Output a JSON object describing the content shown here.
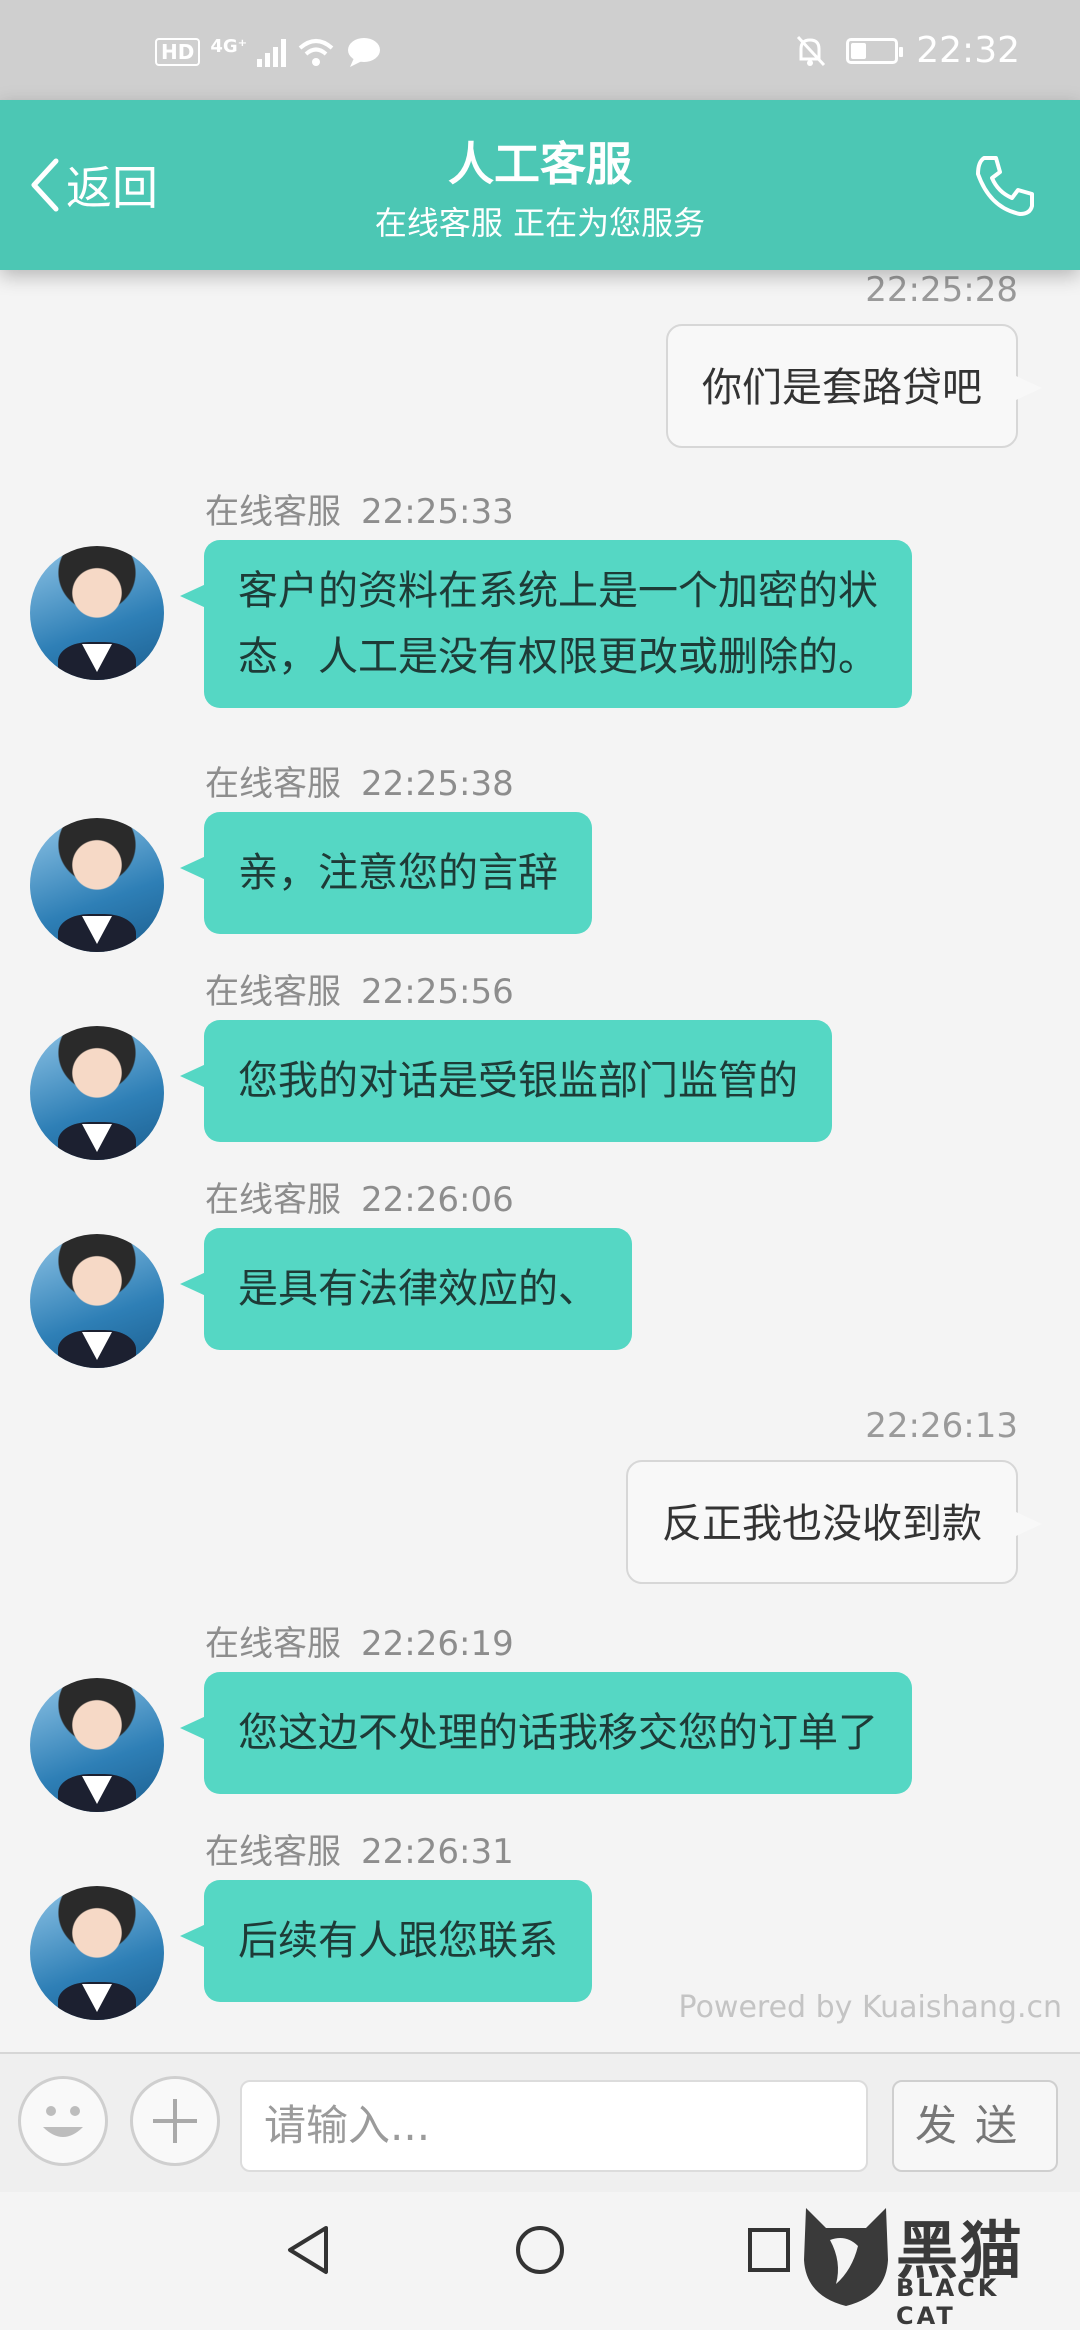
{
  "status_bar": {
    "hd": "HD",
    "network": "4G⁺",
    "time": "22:32",
    "battery_level": 0.35
  },
  "header": {
    "back_label": "返回",
    "title": "人工客服",
    "subtitle": "在线客服 正在为您服务"
  },
  "messages": [
    {
      "side": "user",
      "time": "22:25:28",
      "text": "你们是套路贷吧"
    },
    {
      "side": "agent",
      "name": "在线客服",
      "time": "22:25:33",
      "lines": [
        "客户的资料在系统上是一个加密的状",
        "态，人工是没有权限更改或删除的。"
      ]
    },
    {
      "side": "agent",
      "name": "在线客服",
      "time": "22:25:38",
      "lines": [
        "亲，注意您的言辞"
      ]
    },
    {
      "side": "agent",
      "name": "在线客服",
      "time": "22:25:56",
      "lines": [
        "您我的对话是受银监部门监管的"
      ]
    },
    {
      "side": "agent",
      "name": "在线客服",
      "time": "22:26:06",
      "lines": [
        "是具有法律效应的、"
      ]
    },
    {
      "side": "user",
      "time": "22:26:13",
      "text": "反正我也没收到款"
    },
    {
      "side": "agent",
      "name": "在线客服",
      "time": "22:26:19",
      "lines": [
        "您这边不处理的话我移交您的订单了"
      ]
    },
    {
      "side": "agent",
      "name": "在线客服",
      "time": "22:26:31",
      "lines": [
        "后续有人跟您联系"
      ]
    }
  ],
  "powered_by": "Powered by Kuaishang.cn",
  "input": {
    "placeholder": "请输入...",
    "send_label": "发送"
  },
  "watermark": {
    "cn": "黑猫",
    "en": "BLACK CAT"
  },
  "icons": [
    "back-chevron-icon",
    "phone-icon",
    "smiley-icon",
    "plus-icon",
    "nav-back-icon",
    "nav-home-icon",
    "nav-recent-icon"
  ]
}
